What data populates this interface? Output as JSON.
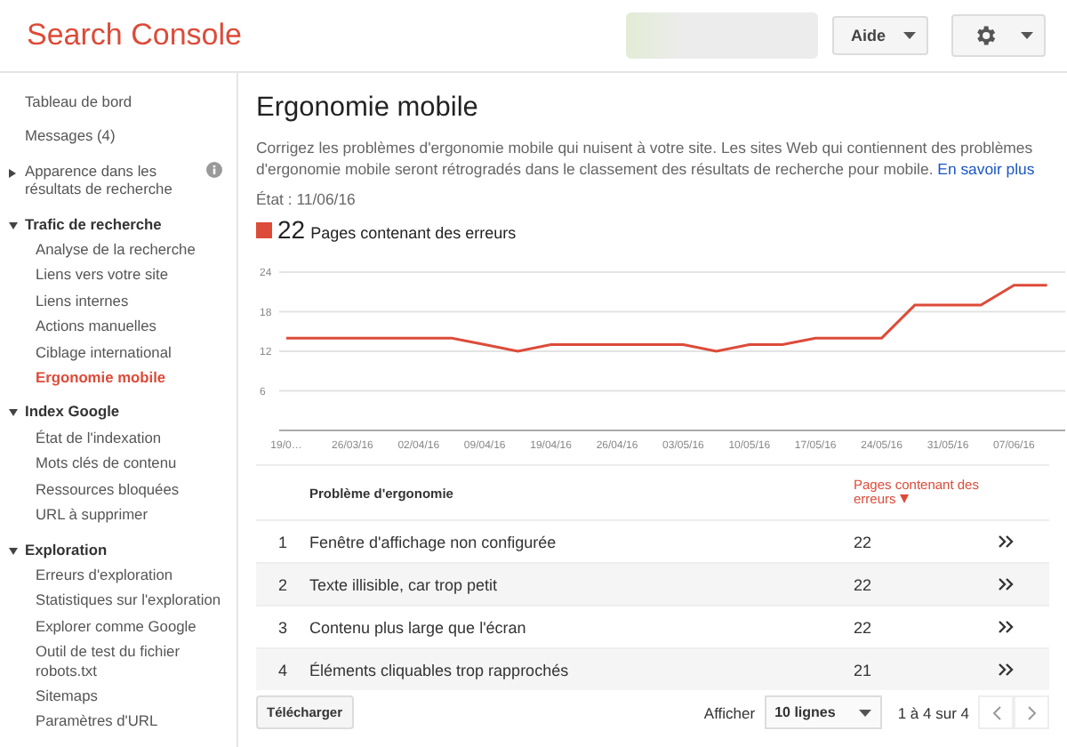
{
  "header": {
    "product": "Search Console",
    "help_button": "Aide"
  },
  "sidebar": {
    "items": [
      {
        "label": "Tableau de bord",
        "kind": "link",
        "selected": false
      },
      {
        "label": "Messages (4)",
        "kind": "link",
        "selected": false
      },
      {
        "label": "Apparence dans les résultats de recherche",
        "kind": "link",
        "selected": false,
        "expanded": false,
        "info": true
      },
      {
        "label": "Trafic de recherche",
        "kind": "section",
        "selected": false,
        "expanded": true,
        "children": [
          {
            "label": "Analyse de la recherche",
            "kind": "link",
            "selected": false
          },
          {
            "label": "Liens vers votre site",
            "kind": "link",
            "selected": false
          },
          {
            "label": "Liens internes",
            "kind": "link",
            "selected": false
          },
          {
            "label": "Actions manuelles",
            "kind": "link",
            "selected": false
          },
          {
            "label": "Ciblage international",
            "kind": "link",
            "selected": false
          },
          {
            "label": "Ergonomie mobile",
            "kind": "link",
            "selected": true
          }
        ]
      },
      {
        "label": "Index Google",
        "kind": "section",
        "selected": false,
        "expanded": true,
        "children": [
          {
            "label": "État de l'indexation",
            "kind": "link",
            "selected": false
          },
          {
            "label": "Mots clés de contenu",
            "kind": "link",
            "selected": false
          },
          {
            "label": "Ressources bloquées",
            "kind": "link",
            "selected": false
          },
          {
            "label": "URL à supprimer",
            "kind": "link",
            "selected": false
          }
        ]
      },
      {
        "label": "Exploration",
        "kind": "section",
        "selected": false,
        "expanded": true,
        "children": [
          {
            "label": "Erreurs d'exploration",
            "kind": "link",
            "selected": false
          },
          {
            "label": "Statistiques sur l'exploration",
            "kind": "link",
            "selected": false
          },
          {
            "label": "Explorer comme Google",
            "kind": "link",
            "selected": false
          },
          {
            "label": "Outil de test du fichier robots.txt",
            "kind": "link",
            "selected": false
          },
          {
            "label": "Sitemaps",
            "kind": "link",
            "selected": false
          },
          {
            "label": "Paramètres d'URL",
            "kind": "link",
            "selected": false
          }
        ]
      }
    ]
  },
  "report": {
    "title": "Ergonomie mobile",
    "description": "Corrigez les problèmes d'ergonomie mobile qui nuisent à votre site. Les sites Web qui contiennent des problèmes d'ergonomie mobile seront rétrogradés dans le classement des résultats de recherche pour mobile.",
    "learn_more": "En savoir plus",
    "status": "État : 11/06/16",
    "legend": {
      "count": "22"
    },
    "chart_data": {
      "type": "line",
      "categories": [
        "19/0…",
        null,
        "26/03/16",
        null,
        "02/04/16",
        null,
        "09/04/16",
        null,
        "19/04/16",
        null,
        "26/04/16",
        null,
        "03/05/16",
        null,
        "10/05/16",
        null,
        "17/05/16",
        null,
        "24/05/16",
        null,
        "31/05/16",
        null,
        "07/06/16",
        null
      ],
      "series": [
        {
          "name": "Pages contenant des erreurs",
          "color": "#dd4b39",
          "values": [
            14,
            14,
            14,
            14,
            14,
            14,
            13,
            12,
            13,
            13,
            13,
            13,
            13,
            12,
            13,
            13,
            14,
            14,
            14,
            19,
            19,
            19,
            22,
            22
          ]
        }
      ],
      "ylim": [
        0,
        24
      ],
      "yticks": [
        6,
        12,
        18,
        24
      ],
      "grid": true
    }
  },
  "table": {
    "columns": [
      {
        "label": "Problème d'ergonomie",
        "sorted": false
      },
      {
        "label": "Pages contenant des erreurs",
        "sorted": true
      }
    ],
    "rows": [
      {
        "index": "1",
        "issue": "Fenêtre d'affichage non configurée",
        "pages": "22"
      },
      {
        "index": "2",
        "issue": "Texte illisible, car trop petit",
        "pages": "22"
      },
      {
        "index": "3",
        "issue": "Contenu plus large que l'écran",
        "pages": "22"
      },
      {
        "index": "4",
        "issue": "Éléments cliquables trop rapprochés",
        "pages": "21"
      }
    ]
  },
  "footer": {
    "download_button": "Télécharger",
    "rows_label": "Afficher",
    "rows_select": "10 lignes",
    "range": "1 à 4 sur 4"
  }
}
